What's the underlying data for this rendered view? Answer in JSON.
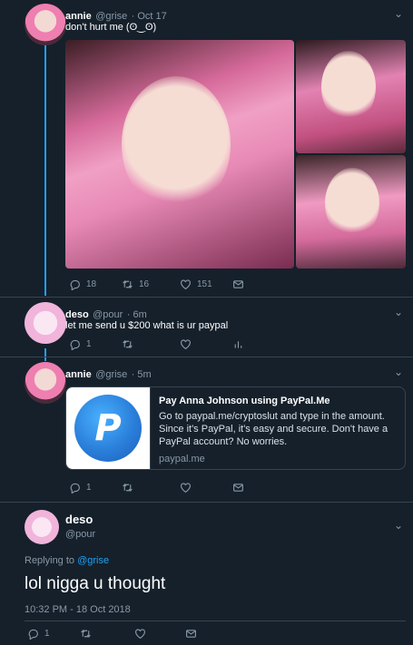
{
  "tweet1": {
    "name": "annie",
    "handle": "@grise",
    "time": "· Oct 17",
    "text": "don't hurt me (ʘ‿ʘ)",
    "reply_count": "18",
    "retweet_count": "16",
    "like_count": "151"
  },
  "tweet2": {
    "name": "deso",
    "handle": "@pour",
    "time": "· 6m",
    "text": "let me send u $200 what is ur paypal",
    "reply_count": "1"
  },
  "tweet3": {
    "name": "annie",
    "handle": "@grise",
    "time": "· 5m",
    "reply_count": "1",
    "card": {
      "logo_letter": "P",
      "title": "Pay Anna Johnson using PayPal.Me",
      "description": "Go to paypal.me/cryptoslut and type in the amount. Since it's PayPal, it's easy and secure. Don't have a PayPal account? No worries.",
      "url": "paypal.me"
    }
  },
  "main_tweet": {
    "name": "deso",
    "handle": "@pour",
    "replying_prefix": "Replying to",
    "replying_to": "@grise",
    "text": "lol nigga u thought",
    "timestamp": "10:32 PM - 18 Oct 2018",
    "reply_count": "1"
  },
  "colors": {
    "background": "#15202b",
    "accent": "#1da1f2",
    "muted": "#8899a6",
    "divider": "#38444d"
  }
}
